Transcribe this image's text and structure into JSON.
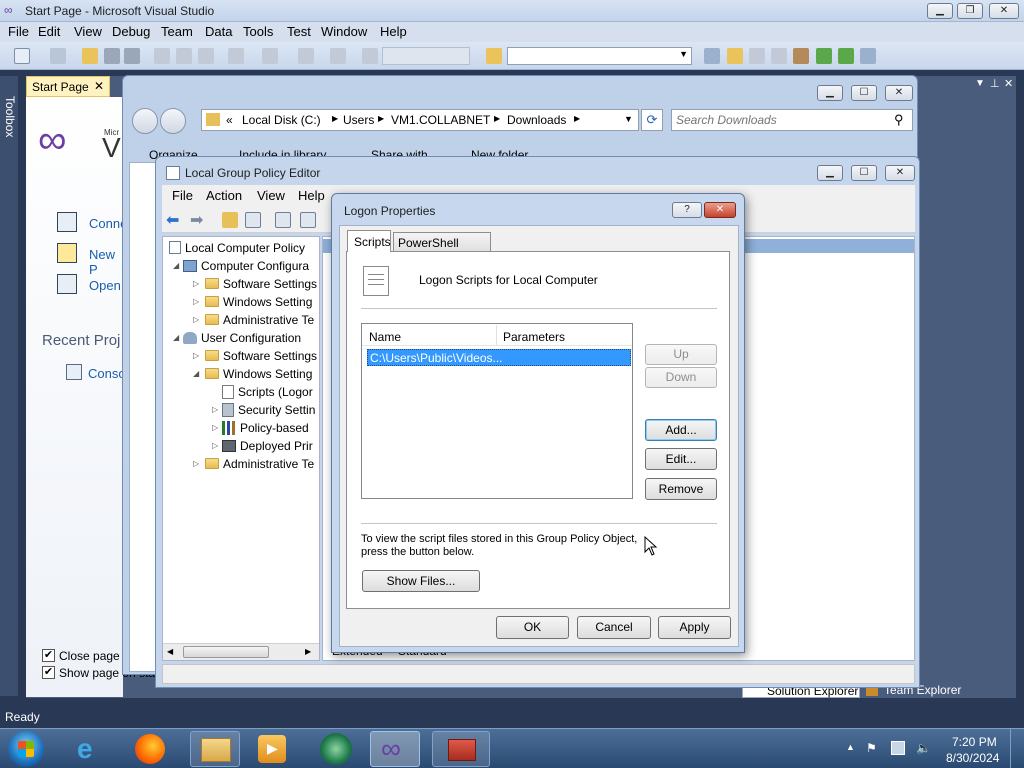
{
  "vs": {
    "title": "Start Page - Microsoft Visual Studio",
    "menu": [
      "File",
      "Edit",
      "View",
      "Debug",
      "Team",
      "Data",
      "Tools",
      "Test",
      "Window",
      "Help"
    ],
    "toolbox_label": "Toolbox",
    "start_tab": "Start Page",
    "logo_text": "Micr",
    "logo_big": "V",
    "links": [
      "Conne",
      "New P",
      "Open"
    ],
    "recent_heading": "Recent Proj",
    "recent_items": [
      "Conso"
    ],
    "checkboxes": [
      "Close page a",
      "Show page on sta"
    ],
    "status": "Ready",
    "side_tabs": [
      "Solution Explorer",
      "Team Explorer"
    ],
    "colors": {
      "titlebar": "#c3d3ea",
      "body_bg": "#293955",
      "accent": "#3399ff"
    }
  },
  "explorer": {
    "address": [
      "Local Disk (C:)",
      "Users",
      "VM1.COLLABNET",
      "Downloads"
    ],
    "address_prefix": "«",
    "search_placeholder": "Search Downloads",
    "toolbar": [
      "Organize",
      "Include in library",
      "Share with",
      "New folder"
    ]
  },
  "gpedit": {
    "title": "Local Group Policy Editor",
    "menu": [
      "File",
      "Action",
      "View",
      "Help"
    ],
    "tree": [
      {
        "label": "Local Computer Policy",
        "level": 0,
        "icon": "policy-icon",
        "twisty": ""
      },
      {
        "label": "Computer Configura",
        "level": 1,
        "icon": "computer-icon",
        "twisty": "◢"
      },
      {
        "label": "Software Settings",
        "level": 2,
        "icon": "folder-icon",
        "twisty": "▷"
      },
      {
        "label": "Windows Setting",
        "level": 2,
        "icon": "folder-icon",
        "twisty": "▷"
      },
      {
        "label": "Administrative Te",
        "level": 2,
        "icon": "folder-icon",
        "twisty": "▷"
      },
      {
        "label": "User Configuration",
        "level": 1,
        "icon": "users-icon",
        "twisty": "◢"
      },
      {
        "label": "Software Settings",
        "level": 2,
        "icon": "folder-icon",
        "twisty": "▷"
      },
      {
        "label": "Windows Setting",
        "level": 2,
        "icon": "folder-icon",
        "twisty": "◢"
      },
      {
        "label": "Scripts (Logor",
        "level": 3,
        "icon": "script-icon",
        "twisty": ""
      },
      {
        "label": "Security Settin",
        "level": 3,
        "icon": "security-icon",
        "twisty": "▷"
      },
      {
        "label": "Policy-based",
        "level": 3,
        "icon": "chart-icon",
        "twisty": "▷"
      },
      {
        "label": "Deployed Prir",
        "level": 3,
        "icon": "printer-icon",
        "twisty": "▷"
      },
      {
        "label": "Administrative Te",
        "level": 2,
        "icon": "folder-icon",
        "twisty": "▷"
      }
    ],
    "bottom_tabs": [
      "Extended",
      "Standard"
    ]
  },
  "dialog": {
    "title": "Logon Properties",
    "help_glyph": "?",
    "tabs": [
      "Scripts",
      "PowerShell Scripts"
    ],
    "heading": "Logon Scripts for Local Computer",
    "columns": [
      "Name",
      "Parameters"
    ],
    "rows": [
      {
        "name": "C:\\Users\\Public\\Videos...",
        "params": ""
      }
    ],
    "buttons": {
      "up": "Up",
      "down": "Down",
      "add": "Add...",
      "edit": "Edit...",
      "remove": "Remove",
      "show_files": "Show Files..."
    },
    "info_text": "To view the script files stored in this Group Policy Object, press the button below.",
    "footer": {
      "ok": "OK",
      "cancel": "Cancel",
      "apply": "Apply"
    }
  },
  "taskbar": {
    "time": "7:20 PM",
    "date": "8/30/2024"
  }
}
